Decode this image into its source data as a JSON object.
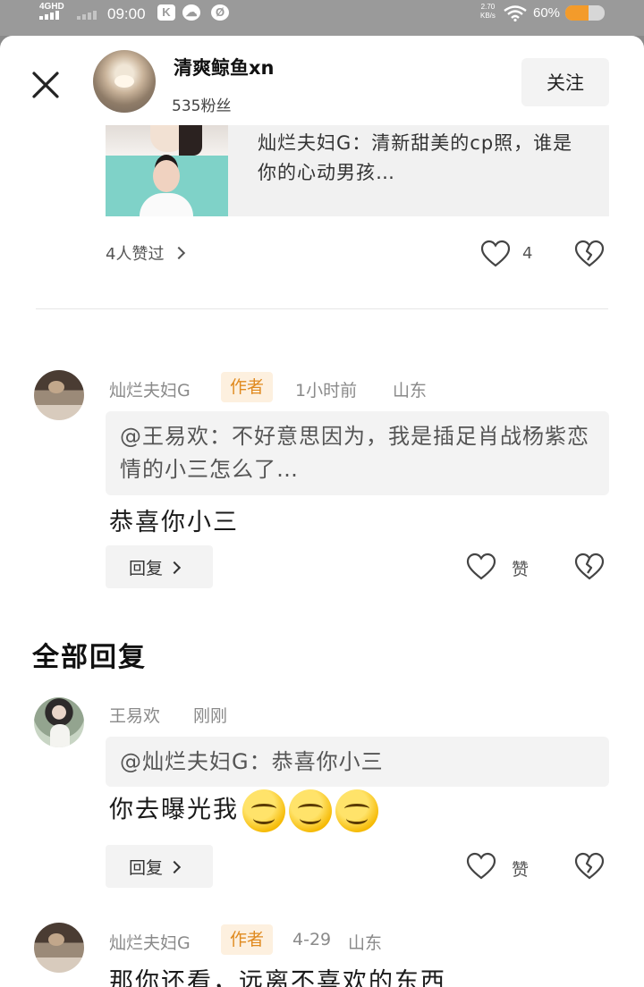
{
  "status_bar": {
    "network": "4GHD",
    "time": "09:00",
    "app_icons": [
      "K",
      "☁",
      "Ø"
    ],
    "net_speed_value": "2.70",
    "net_speed_unit": "KB/s",
    "battery_text": "60%",
    "battery_level": 0.6
  },
  "header": {
    "username": "清爽鲸鱼xn",
    "fans": "535粉丝",
    "follow_label": "关注"
  },
  "shared_post": {
    "text": "灿烂夫妇G：清新甜美的cp照，谁是你的心动男孩…",
    "likes_summary": "4人赞过",
    "like_count": "4"
  },
  "author_comment": {
    "name": "灿烂夫妇G",
    "author_tag": "作者",
    "time": "1小时前",
    "location": "山东",
    "quote": "@王易欢：不好意思因为，我是插足肖战杨紫恋情的小三怎么了…",
    "text": "恭喜你小三",
    "reply_label": "回复",
    "like_label": "赞"
  },
  "section_title": "全部回复",
  "replies": [
    {
      "name": "王易欢",
      "time": "刚刚",
      "quote": "@灿烂夫妇G：恭喜你小三",
      "text": "你去曝光我",
      "emoji_count": 3,
      "reply_label": "回复",
      "like_label": "赞"
    },
    {
      "name": "灿烂夫妇G",
      "author_tag": "作者",
      "time": "4-29",
      "location": "山东",
      "text": "那你还看，远离不喜欢的东西"
    }
  ],
  "icons": {
    "close": "close-icon",
    "like": "heart-icon",
    "dislike": "broken-heart-icon",
    "chevron": "chevron-right-icon"
  }
}
